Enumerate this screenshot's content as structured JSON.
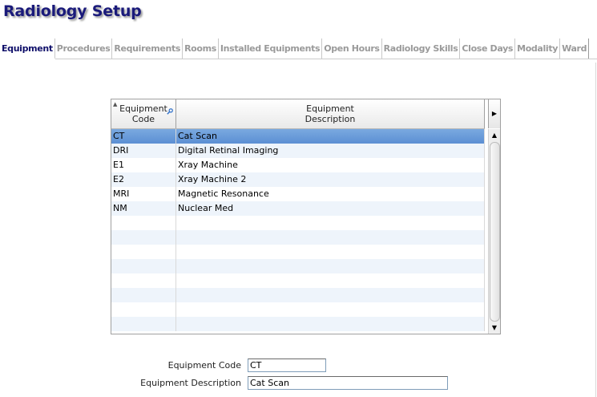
{
  "title": "Radiology Setup",
  "tabs": [
    {
      "label": "Equipment",
      "active": true
    },
    {
      "label": "Procedures",
      "active": false
    },
    {
      "label": "Requirements",
      "active": false
    },
    {
      "label": "Rooms",
      "active": false
    },
    {
      "label": "Installed Equipments",
      "active": false
    },
    {
      "label": "Open Hours",
      "active": false
    },
    {
      "label": "Radiology Skills",
      "active": false
    },
    {
      "label": "Close Days",
      "active": false
    },
    {
      "label": "Modality",
      "active": false
    },
    {
      "label": "Ward",
      "active": false
    }
  ],
  "grid": {
    "columns": {
      "code": {
        "line1": "Equipment",
        "line2": "Code"
      },
      "desc": {
        "line1": "Equipment",
        "line2": "Description"
      }
    },
    "rows": [
      {
        "code": "CT",
        "desc": "Cat Scan"
      },
      {
        "code": "DRI",
        "desc": "Digital Retinal Imaging"
      },
      {
        "code": "E1",
        "desc": "Xray Machine"
      },
      {
        "code": "E2",
        "desc": "Xray Machine 2"
      },
      {
        "code": "MRI",
        "desc": "Magnetic Resonance"
      },
      {
        "code": "NM",
        "desc": "Nuclear Med"
      }
    ],
    "selected_index": 0,
    "icons": {
      "sort": "sort-indicator-icon",
      "filter": "magnifier-icon",
      "column_menu": "triangle-right-icon",
      "scroll_up": "triangle-up-icon",
      "scroll_down": "triangle-down-icon"
    }
  },
  "form": {
    "code_label": "Equipment Code",
    "code_value": "CT",
    "desc_label": "Equipment Description",
    "desc_value": "Cat Scan"
  },
  "colors": {
    "title": "#1a1a7a",
    "active_tab": "#10106a",
    "inactive_tab": "#9a9a9a",
    "selected_row": "#6b9bd8",
    "alt_row": "#eef4fb"
  }
}
